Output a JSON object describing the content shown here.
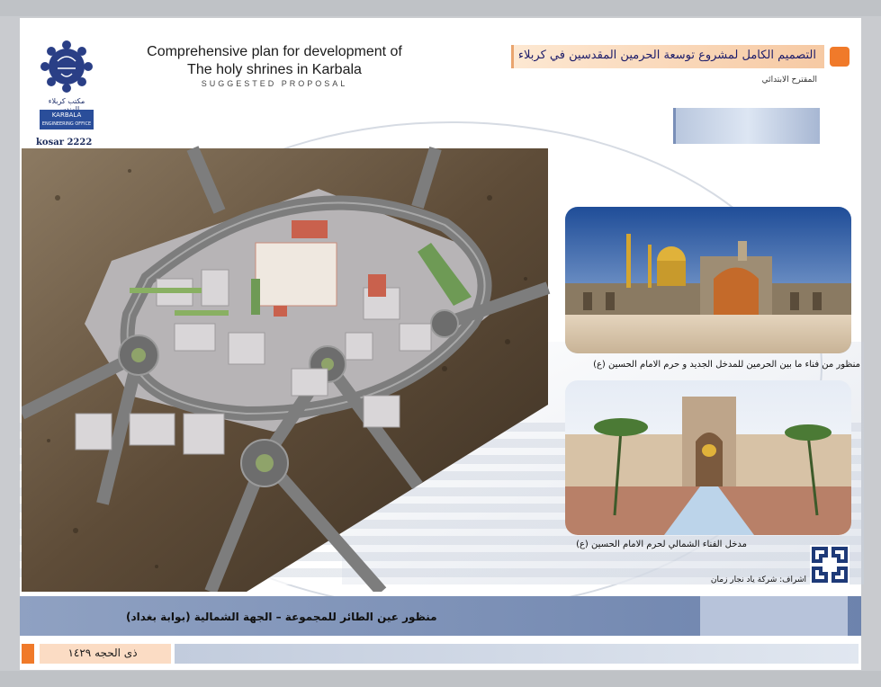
{
  "header": {
    "title_line1": "Comprehensive plan for development of",
    "title_line2": "The holy shrines in Karbala",
    "subtitle": "Suggested Proposal",
    "arabic_title": "التصميم الكامل لمشروع توسعة الحرمين المقدسين في كربلاء",
    "arabic_subtitle": "المقترح الابتدائي"
  },
  "logo": {
    "caption": "مكتب كربلاء الهندسي",
    "box_line1": "KARBALA",
    "box_line2": "ENGINEERING OFFICE",
    "id_label": "kosar 2222"
  },
  "photos": {
    "caption1": "منظور من فناء ما بين الحرمين للمدخل الجديد و حرم الامام الحسين (ع)",
    "caption2": "مدخل الفناء الشمالي لحرم الامام الحسين (ع)"
  },
  "footer": {
    "supervision": "اشراف: شركة ياد نجار زمان",
    "main_caption": "منظور عين الطائر للمجموعة – الجهة الشمالية (بوابة بغداد)",
    "date": "ذى الحجه ١٤٢٩"
  },
  "colors": {
    "accent_orange": "#f07a2a",
    "navy": "#1e2f6a",
    "caption_bar": "#6d83ad"
  }
}
